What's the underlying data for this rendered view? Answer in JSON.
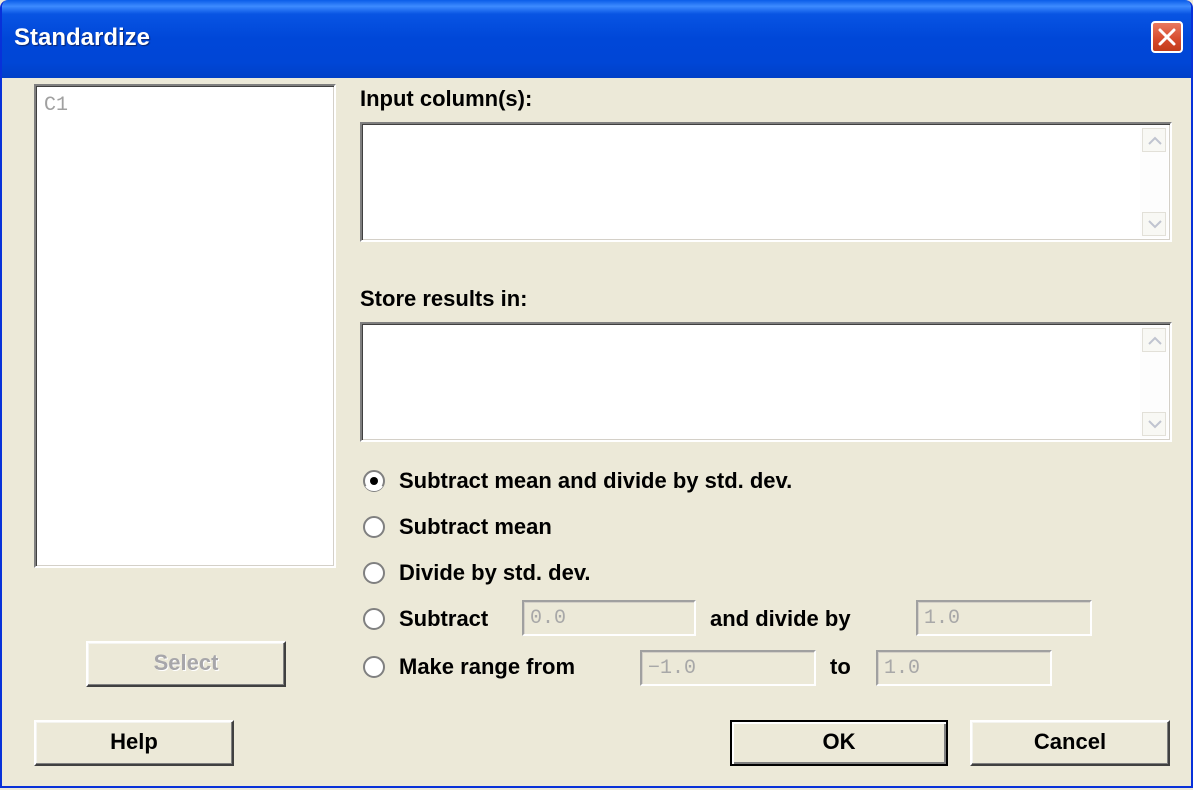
{
  "window": {
    "title": "Standardize"
  },
  "column_list": {
    "items": [
      "C1"
    ]
  },
  "input_columns": {
    "label": "Input column(s):",
    "value": ""
  },
  "store_results": {
    "label": "Store results in:",
    "value": ""
  },
  "options": {
    "selected": "subtract_mean_divide_std",
    "subtract_mean_divide_std": "Subtract mean and divide by std. dev.",
    "subtract_mean": "Subtract mean",
    "divide_std": "Divide by std. dev.",
    "subtract_label": "Subtract",
    "subtract_value": "0.0",
    "divide_by_label": "and divide by",
    "divide_by_value": "1.0",
    "make_range_label": "Make range from",
    "range_from_value": "−1.0",
    "to_label": "to",
    "range_to_value": "1.0"
  },
  "buttons": {
    "select": "Select",
    "help": "Help",
    "ok": "OK",
    "cancel": "Cancel"
  }
}
